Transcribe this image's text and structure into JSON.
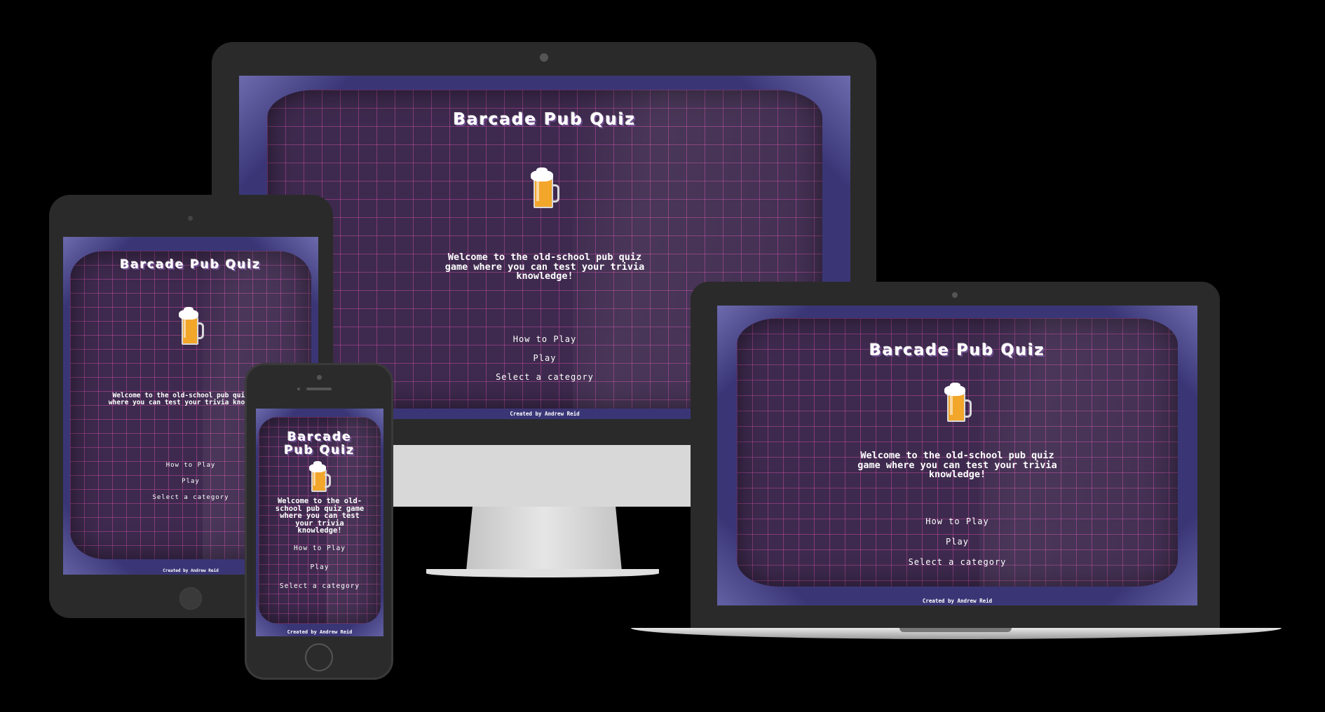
{
  "app": {
    "title_line1": "Barcade",
    "title_line2": "Pub Quiz",
    "title": "Barcade Pub Quiz",
    "welcome": "Welcome to the old-school pub quiz game where you can test your trivia knowledge!",
    "menu": {
      "how_to_play": "How to Play",
      "play": "Play",
      "select_category": "Select a category"
    },
    "footer": "Created by Andrew Reid"
  },
  "icons": {
    "mug": "beer-mug-icon"
  },
  "colors": {
    "background": "#000000",
    "frame": "#3a3676",
    "crt": "#3e2a4e",
    "grid": "#d250aa",
    "beer": "#f2a62a",
    "device": "#2a2a2a",
    "stand": "#d8d8d8"
  }
}
